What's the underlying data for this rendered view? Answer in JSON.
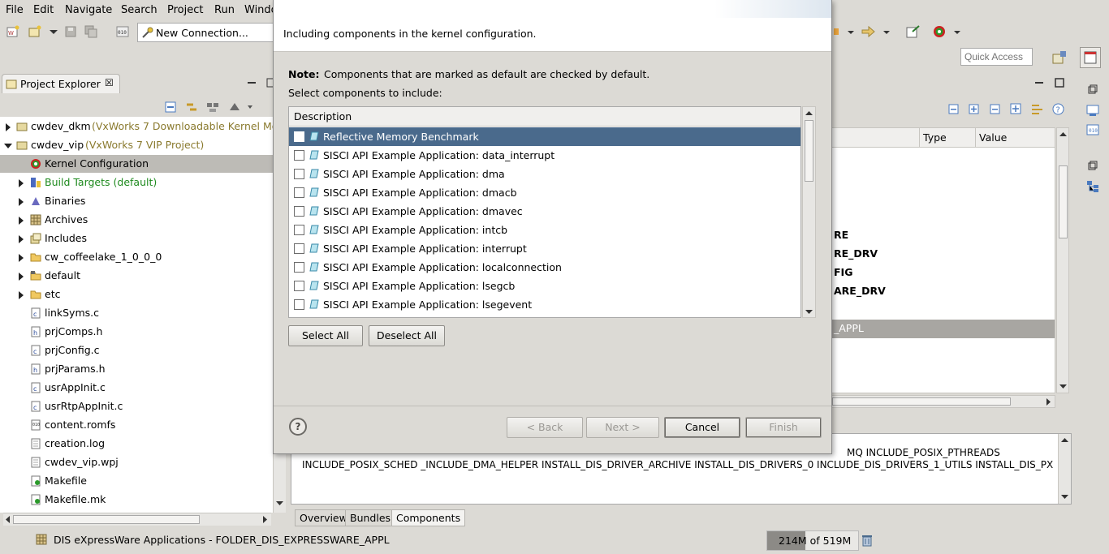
{
  "menu": [
    "File",
    "Edit",
    "Navigate",
    "Search",
    "Project",
    "Run",
    "Windo"
  ],
  "toolbar": {
    "connection_label": "New Connection...",
    "quick_access_placeholder": "Quick Access"
  },
  "project_explorer": {
    "tab_label": "Project Explorer",
    "tab_close": "☒",
    "tree": [
      {
        "label": "cwdev_dkm",
        "suffix": "(VxWorks 7 Downloadable Kernel Mo",
        "state": "closed",
        "icon": "project-icon"
      },
      {
        "label": "cwdev_vip",
        "suffix": "(VxWorks 7 VIP Project)",
        "state": "open",
        "icon": "project-icon"
      },
      {
        "label": "Kernel Configuration",
        "icon": "kernel-config-icon",
        "selected": true
      },
      {
        "label": "Build Targets (default)",
        "state": "closed",
        "icon": "build-targets-icon",
        "green": true
      },
      {
        "label": "Binaries",
        "state": "closed",
        "icon": "binaries-icon"
      },
      {
        "label": "Archives",
        "state": "closed",
        "icon": "archives-icon"
      },
      {
        "label": "Includes",
        "state": "closed",
        "icon": "includes-icon"
      },
      {
        "label": "cw_coffeelake_1_0_0_0",
        "state": "closed",
        "icon": "folder-icon"
      },
      {
        "label": "default",
        "state": "closed",
        "icon": "folder-icon"
      },
      {
        "label": "etc",
        "state": "closed",
        "icon": "folder-icon"
      },
      {
        "label": "linkSyms.c",
        "icon": "c-file-icon"
      },
      {
        "label": "prjComps.h",
        "icon": "h-file-icon"
      },
      {
        "label": "prjConfig.c",
        "icon": "c-file-icon"
      },
      {
        "label": "prjParams.h",
        "icon": "h-file-icon"
      },
      {
        "label": "usrAppInit.c",
        "icon": "c-file-icon"
      },
      {
        "label": "usrRtpAppInit.c",
        "icon": "c-file-icon"
      },
      {
        "label": "content.romfs",
        "icon": "romfs-file-icon"
      },
      {
        "label": "creation.log",
        "icon": "text-file-icon"
      },
      {
        "label": "cwdev_vip.wpj",
        "icon": "text-file-icon"
      },
      {
        "label": "Makefile",
        "icon": "makefile-icon"
      },
      {
        "label": "Makefile.mk",
        "icon": "makefile-icon"
      }
    ]
  },
  "editor": {
    "columns": [
      "Type",
      "Value"
    ],
    "partial_rows": [
      "RE",
      "RE_DRV",
      "FIG",
      "ARE_DRV",
      "_APPL"
    ],
    "info_text_line1": "MQ INCLUDE_POSIX_PTHREADS",
    "info_text_line2": "INCLUDE_POSIX_SCHED _INCLUDE_DMA_HELPER INSTALL_DIS_DRIVER_ARCHIVE INSTALL_DIS_DRIVERS_0 INCLUDE_DIS_DRIVERS_1_UTILS INSTALL_DIS_PX",
    "tabs": [
      "Overview",
      "Bundles",
      "Components"
    ]
  },
  "dialog": {
    "subtitle": "Including components in the kernel configuration.",
    "note_label": "Note:",
    "note_text": "Components that are marked as default are checked by default.",
    "select_label": "Select components to include:",
    "column_header": "Description",
    "components": [
      {
        "label": "Reflective Memory Benchmark",
        "checked": false,
        "selected": true
      },
      {
        "label": "SISCI API Example Application: data_interrupt",
        "checked": false
      },
      {
        "label": "SISCI API Example Application: dma",
        "checked": false
      },
      {
        "label": "SISCI API Example Application: dmacb",
        "checked": false
      },
      {
        "label": "SISCI API Example Application: dmavec",
        "checked": false
      },
      {
        "label": "SISCI API Example Application: intcb",
        "checked": false
      },
      {
        "label": "SISCI API Example Application: interrupt",
        "checked": false
      },
      {
        "label": "SISCI API Example Application: localconnection",
        "checked": false
      },
      {
        "label": "SISCI API Example Application: lsegcb",
        "checked": false
      },
      {
        "label": "SISCI API Example Application: lsegevent",
        "checked": false
      }
    ],
    "buttons": {
      "select_all": "Select All",
      "deselect_all": "Deselect All",
      "back": "< Back",
      "next": "Next >",
      "cancel": "Cancel",
      "finish": "Finish"
    },
    "help_glyph": "?"
  },
  "status": {
    "selection_text": "DIS eXpressWare Applications - FOLDER_DIS_EXPRESSWARE_APPL",
    "heap_text": "214M of 519M",
    "heap_used_mb": 214,
    "heap_total_mb": 519
  },
  "colors": {
    "window_bg": "#dcdad5",
    "selection_blue": "#4a6a8c",
    "selection_gray": "#bdbbb6",
    "green_text": "#1e8a1e",
    "olive_text": "#8a7a2e"
  }
}
